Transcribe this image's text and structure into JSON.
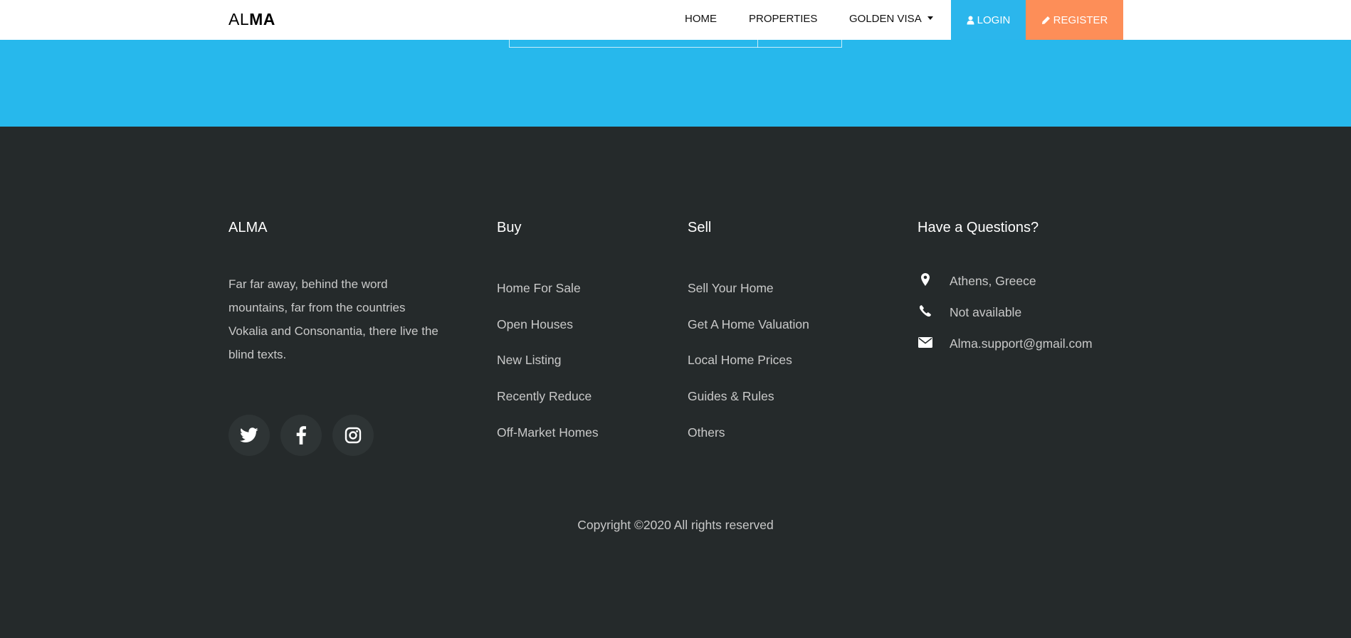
{
  "navbar": {
    "logo_light": "AL",
    "logo_bold": "MA",
    "items": [
      "HOME",
      "PROPERTIES",
      "GOLDEN VISA"
    ],
    "login_label": "LOGIN",
    "register_label": "REGISTER",
    "colors": {
      "login": "#2bb6ec",
      "register": "#fd8e58"
    }
  },
  "band_color": "#27b8ec",
  "footer": {
    "about": {
      "title": "ALMA",
      "text": "Far far away, behind the word mountains, far from the countries Vokalia and Consonantia, there live the blind texts.",
      "social": [
        "twitter-icon",
        "facebook-icon",
        "instagram-icon"
      ]
    },
    "buy": {
      "title": "Buy",
      "links": [
        "Home For Sale",
        "Open Houses",
        "New Listing",
        "Recently Reduce",
        "Off-Market Homes"
      ]
    },
    "sell": {
      "title": "Sell",
      "links": [
        "Sell Your Home",
        "Get A Home Valuation",
        "Local Home Prices",
        "Guides & Rules",
        "Others"
      ]
    },
    "contact": {
      "title": "Have a Questions?",
      "address": "Athens, Greece",
      "phone": "Not available",
      "email": "Alma.support@gmail.com"
    },
    "copyright": "Copyright ©2020 All rights reserved"
  }
}
